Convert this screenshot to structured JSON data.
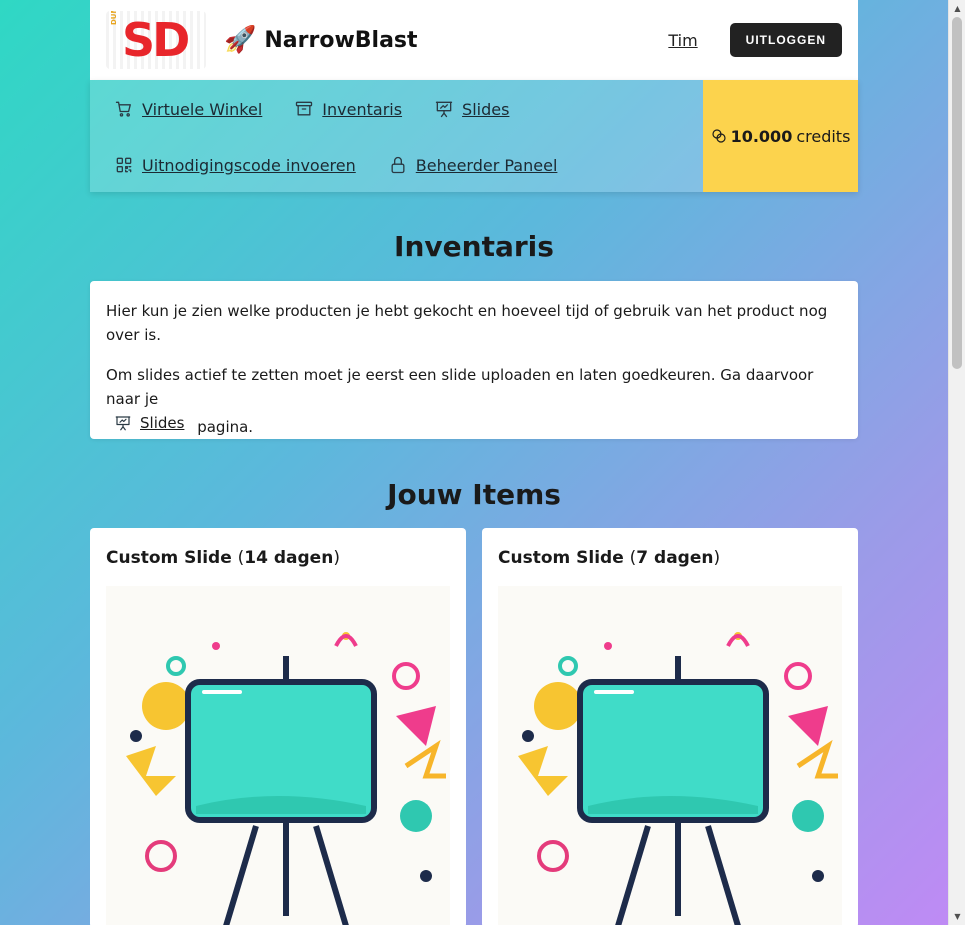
{
  "header": {
    "logo_text": "SD",
    "logo_small": "DUMO",
    "brand_emoji": "🚀",
    "brand_name": "NarrowBlast",
    "user_name": "Tim",
    "logout_label": "UITLOGGEN"
  },
  "nav": {
    "items": [
      {
        "label": "Virtuele Winkel",
        "icon": "cart-icon"
      },
      {
        "label": "Inventaris",
        "icon": "archive-icon"
      },
      {
        "label": "Slides",
        "icon": "presentation-icon"
      },
      {
        "label": "Uitnodigingscode invoeren",
        "icon": "qr-code-icon"
      },
      {
        "label": "Beheerder Paneel",
        "icon": "lock-icon"
      }
    ],
    "credits_amount": "10.000",
    "credits_label": "credits"
  },
  "page": {
    "title": "Inventaris",
    "intro_1": "Hier kun je zien welke producten je hebt gekocht en hoeveel tijd of gebruik van het product nog over is.",
    "intro_2_before": "Om slides actief te zetten moet je eerst een slide uploaden en laten goedkeuren. Ga daarvoor naar je",
    "intro_2_link": "Slides",
    "intro_2_after": "pagina.",
    "items_title": "Jouw Items"
  },
  "items": [
    {
      "name": "Custom Slide",
      "open": "(",
      "duration": "14 dagen",
      "close": ")"
    },
    {
      "name": "Custom Slide",
      "open": "(",
      "duration": "7 dagen",
      "close": ")"
    }
  ],
  "colors": {
    "credits_bg": "#fcd34d",
    "logout_bg": "#222222",
    "logo_red": "#e8262b",
    "screen_teal": "#40dcc8"
  }
}
